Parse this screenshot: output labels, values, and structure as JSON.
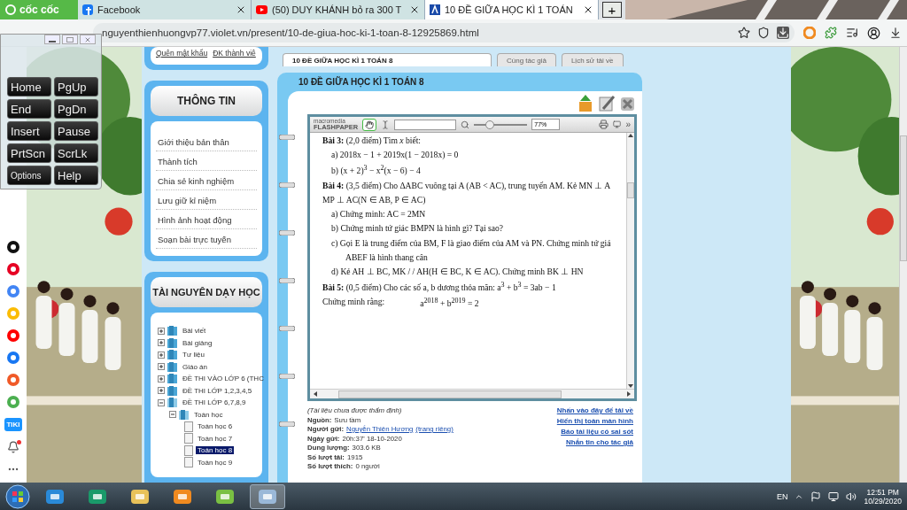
{
  "browser": {
    "logo": "cốc cốc",
    "tabs": [
      {
        "title": "Facebook",
        "kind": "facebook",
        "selected": false
      },
      {
        "title": "(50) DUY KHÁNH bỏ ra 300 T",
        "kind": "youtube",
        "selected": false
      },
      {
        "title": "10 ĐỀ GIỮA HỌC KÌ 1 TOÁN",
        "kind": "site",
        "selected": true
      }
    ],
    "new_tab": "+",
    "url": "nguyenthienhuongvp77.violet.vn/present/10-de-giua-hoc-ki-1-toan-8-12925869.html"
  },
  "keyboard": {
    "keys": [
      "Home",
      "PgUp",
      "End",
      "PgDn",
      "Insert",
      "Pause",
      "PrtScn",
      "ScrLk",
      "Options",
      "Help"
    ]
  },
  "sidebar_apps": [
    {
      "kind": "tiktok"
    },
    {
      "kind": "pinterest"
    },
    {
      "kind": "translate"
    },
    {
      "kind": "chrome"
    },
    {
      "kind": "youtube"
    },
    {
      "kind": "messenger"
    },
    {
      "kind": "shop"
    },
    {
      "kind": "games"
    },
    {
      "kind": "tiki",
      "label": "TIKI"
    },
    {
      "kind": "bell"
    },
    {
      "kind": "more"
    }
  ],
  "login_box": {
    "links": [
      "Quên mật khẩu",
      "ĐK thành viê"
    ]
  },
  "info_box": {
    "title": "THÔNG TIN",
    "items": [
      "Giới thiệu bản thân",
      "Thành tích",
      "Chia sẻ kinh nghiệm",
      "Lưu giữ kỉ niệm",
      "Hình ảnh hoạt động",
      "Soạn bài trực tuyến"
    ]
  },
  "resources_box": {
    "title": "TÀI NGUYÊN DẠY HỌC",
    "tree": [
      {
        "label": "Bài viết",
        "kind": "folder",
        "expanded": false,
        "selected": false
      },
      {
        "label": "Bài giảng",
        "kind": "folder",
        "expanded": false,
        "selected": false
      },
      {
        "label": "Tư liệu",
        "kind": "folder",
        "expanded": false,
        "selected": false
      },
      {
        "label": "Giáo án",
        "kind": "folder",
        "expanded": false,
        "selected": false
      },
      {
        "label": "ĐỀ THI VÀO LỚP 6 (THC",
        "kind": "folder",
        "expanded": false,
        "selected": false
      },
      {
        "label": "ĐỀ THI LỚP 1,2,3,4,5",
        "kind": "folder",
        "expanded": false,
        "selected": false
      },
      {
        "label": "ĐỀ THI LỚP 6,7,8,9",
        "kind": "folder",
        "expanded": true,
        "selected": false,
        "children": [
          {
            "label": "Toán học",
            "kind": "folder",
            "expanded": true,
            "selected": false,
            "children": [
              {
                "label": "Toán học 6",
                "kind": "page",
                "selected": false
              },
              {
                "label": "Toán học 7",
                "kind": "page",
                "selected": false
              },
              {
                "label": "Toán học 8",
                "kind": "page",
                "selected": true
              },
              {
                "label": "Toán học 9",
                "kind": "page",
                "selected": false
              }
            ]
          }
        ]
      }
    ]
  },
  "page_tabs": [
    {
      "label": "10 ĐỀ GIỮA HỌC KÌ 1 TOÁN 8",
      "selected": true
    },
    {
      "label": "Cùng tác giả",
      "selected": false
    },
    {
      "label": "Lịch sử tải về",
      "selected": false
    }
  ],
  "document": {
    "title": "10 ĐỀ GIỮA HỌC KÌ 1 TOÁN 8",
    "viewer": {
      "brand_top": "macromedia",
      "brand": "FLASHPAPER",
      "hand_tool_selected": true,
      "zoom": {
        "level": 0.3,
        "value": "77%"
      },
      "more": "»",
      "lines": [
        {
          "kind": "para",
          "text": "**Bài 3:** (2,0 điểm) Tìm *x* biết:"
        },
        {
          "kind": "item",
          "text": "a)  2018x − 1 + 2019x(1 − 2018x) = 0"
        },
        {
          "kind": "item",
          "text": "b)  (x + 2)$^{3}$ − x$^{2}$(x − 6) − 4"
        },
        {
          "kind": "para",
          "text": "**Bài 4:** (3,5 điểm) Cho ΔABC vuông tại A (AB < AC), trung tuyến AM. Kẻ MN ⊥ A"
        },
        {
          "kind": "para",
          "text": "MP ⊥ AC(N ∈ AB, P ∈ AC)"
        },
        {
          "kind": "item",
          "text": "a)  Chứng minh: AC = 2MN"
        },
        {
          "kind": "item",
          "text": "b)  Chứng minh tứ giác BMPN là hình gì? Tại sao?"
        },
        {
          "kind": "item",
          "text": "c)  Gọi E là trung điểm của BM, F là giao điểm của AM và PN. Chứng minh tứ giá"
        },
        {
          "kind": "continued",
          "text": "ABEF là hình thang cân"
        },
        {
          "kind": "item",
          "text": "d)  Kẻ AH ⊥ BC, MK / / AH(H ∈ BC, K ∈ AC). Chứng minh  BK ⊥ HN"
        },
        {
          "kind": "para",
          "text": "**Bài 5:** (0,5 điểm) Cho các số a, b dương thỏa mãn: a$^{3}$ + b$^{3}$ = 3ab − 1"
        },
        {
          "kind": "para",
          "text": "Chứng minh rằng:",
          "formula": "a$^{2018}$ + b$^{2019}$ = 2"
        }
      ]
    },
    "note": "(Tài liệu chưa được thẩm định)",
    "details": [
      {
        "label": "Nguồn:",
        "value": "Sưu tầm"
      },
      {
        "label": "Người gửi:",
        "links": [
          "Nguyễn Thiên Hương",
          "(trang riêng)"
        ]
      },
      {
        "label": "Ngày gửi:",
        "value": "20h:37' 18-10-2020"
      },
      {
        "label": "Dung lượng:",
        "value": "303.6 KB"
      },
      {
        "label": "Số lượt tải:",
        "value": "1915"
      },
      {
        "label": "Số lượt thích:",
        "value": "0 người"
      }
    ],
    "actions": [
      "Nhấn vào đây để tải về",
      "Hiển thị toàn màn hình",
      "Báo tài liệu có sai sót",
      "Nhắn tin cho tác giả"
    ]
  },
  "taskbar": {
    "apps": [
      {
        "kind": "ie",
        "active": false
      },
      {
        "kind": "green",
        "active": false
      },
      {
        "kind": "folder",
        "active": false
      },
      {
        "kind": "media",
        "active": false
      },
      {
        "kind": "coccoc",
        "active": false
      },
      {
        "kind": "keyboard",
        "active": true
      }
    ],
    "language": "EN",
    "time": "12:51 PM",
    "date": "10/29/2020"
  }
}
